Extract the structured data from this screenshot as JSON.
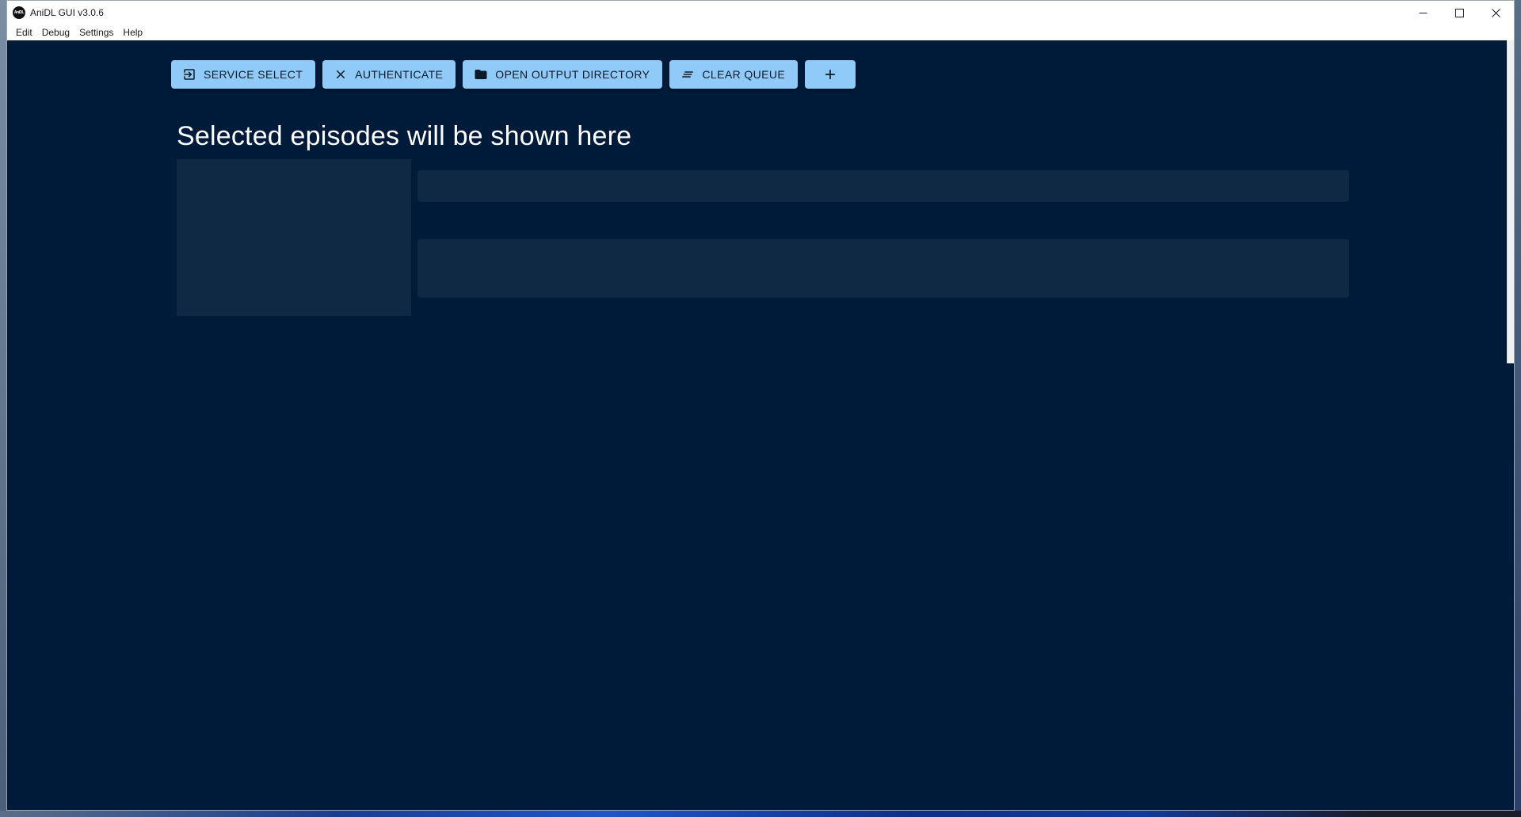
{
  "window": {
    "title": "AniDL GUI v3.0.6",
    "logo_text": "AniDL",
    "controls": {
      "minimize": "—",
      "maximize": "☐",
      "close": "✕"
    }
  },
  "menu": [
    "Edit",
    "Debug",
    "Settings",
    "Help"
  ],
  "toolbar": {
    "service_select": "SERVICE SELECT",
    "authenticate": "AUTHENTICATE",
    "open_output_directory": "OPEN OUTPUT DIRECTORY",
    "clear_queue": "CLEAR QUEUE",
    "add": "+"
  },
  "icons": {
    "service_select": "login-icon",
    "authenticate": "close-icon",
    "open_output_directory": "folder-icon",
    "clear_queue": "clear-all-icon",
    "add": "plus-icon"
  },
  "main": {
    "heading": "Selected episodes will be shown here"
  },
  "colors": {
    "background": "#001b39",
    "button": "#90caf9",
    "skeleton": "#0f2944"
  }
}
